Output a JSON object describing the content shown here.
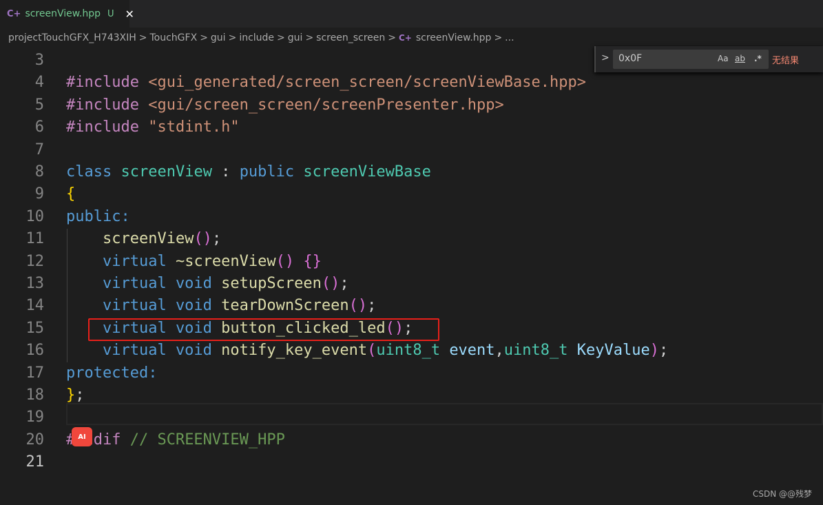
{
  "tab": {
    "icon": "cpp-file-icon",
    "title": "screenView.hpp",
    "status": "U",
    "close": "✕"
  },
  "breadcrumb": [
    "projectTouchGFX_H743XIH",
    "TouchGFX",
    "gui",
    "include",
    "gui",
    "screen_screen",
    "screenView.hpp",
    "..."
  ],
  "find": {
    "value": "0x0F",
    "match_case": "Aa",
    "whole_word": "ab",
    "regex": ".*",
    "result": "无结果"
  },
  "current_line": 21,
  "lines": [
    {
      "n": 3,
      "tokens": []
    },
    {
      "n": 4,
      "tokens": [
        [
          "#include ",
          "pp"
        ],
        [
          "<gui_generated/screen_screen/screenViewBase.hpp>",
          "str"
        ]
      ]
    },
    {
      "n": 5,
      "tokens": [
        [
          "#include ",
          "pp"
        ],
        [
          "<gui/screen_screen/screenPresenter.hpp>",
          "str"
        ]
      ]
    },
    {
      "n": 6,
      "tokens": [
        [
          "#include ",
          "pp"
        ],
        [
          "\"stdint.h\"",
          "str"
        ]
      ]
    },
    {
      "n": 7,
      "tokens": []
    },
    {
      "n": 8,
      "tokens": [
        [
          "class ",
          "kw"
        ],
        [
          "screenView",
          "type"
        ],
        [
          " : ",
          "pl"
        ],
        [
          "public ",
          "kw"
        ],
        [
          "screenViewBase",
          "type"
        ]
      ]
    },
    {
      "n": 9,
      "tokens": [
        [
          "{",
          "br"
        ]
      ]
    },
    {
      "n": 10,
      "tokens": [
        [
          "public:",
          "kw"
        ]
      ]
    },
    {
      "n": 11,
      "tokens": [
        [
          "    screenView",
          "fn"
        ],
        [
          "()",
          "par"
        ],
        [
          ";",
          "pl"
        ]
      ]
    },
    {
      "n": 12,
      "tokens": [
        [
          "    virtual ",
          "kw"
        ],
        [
          "~screenView",
          "fn"
        ],
        [
          "()",
          "par"
        ],
        [
          " ",
          "pl"
        ],
        [
          "{}",
          "par"
        ]
      ]
    },
    {
      "n": 13,
      "tokens": [
        [
          "    virtual void ",
          "kw"
        ],
        [
          "setupScreen",
          "fn"
        ],
        [
          "()",
          "par"
        ],
        [
          ";",
          "pl"
        ]
      ]
    },
    {
      "n": 14,
      "tokens": [
        [
          "    virtual void ",
          "kw"
        ],
        [
          "tearDownScreen",
          "fn"
        ],
        [
          "()",
          "par"
        ],
        [
          ";",
          "pl"
        ]
      ]
    },
    {
      "n": 15,
      "tokens": [
        [
          "    virtual void ",
          "kw"
        ],
        [
          "button_clicked_led",
          "fn"
        ],
        [
          "()",
          "par"
        ],
        [
          ";",
          "pl"
        ]
      ]
    },
    {
      "n": 16,
      "tokens": [
        [
          "    virtual void ",
          "kw"
        ],
        [
          "notify_key_event",
          "fn"
        ],
        [
          "(",
          "par"
        ],
        [
          "uint8_t ",
          "type"
        ],
        [
          "event",
          "var"
        ],
        [
          ",",
          "pl"
        ],
        [
          "uint8_t ",
          "type"
        ],
        [
          "KeyValue",
          "var"
        ],
        [
          ")",
          "par"
        ],
        [
          ";",
          "pl"
        ]
      ]
    },
    {
      "n": 17,
      "tokens": [
        [
          "protected:",
          "kw"
        ]
      ]
    },
    {
      "n": 18,
      "tokens": [
        [
          "}",
          "br"
        ],
        [
          ";",
          "pl"
        ]
      ]
    },
    {
      "n": 19,
      "tokens": []
    },
    {
      "n": 20,
      "tokens": [
        [
          "#endif ",
          "pp"
        ],
        [
          "// SCREENVIEW_HPP",
          "cm"
        ]
      ]
    },
    {
      "n": 21,
      "tokens": []
    }
  ],
  "ai_badge": "AI",
  "watermark": "CSDN @@残梦"
}
